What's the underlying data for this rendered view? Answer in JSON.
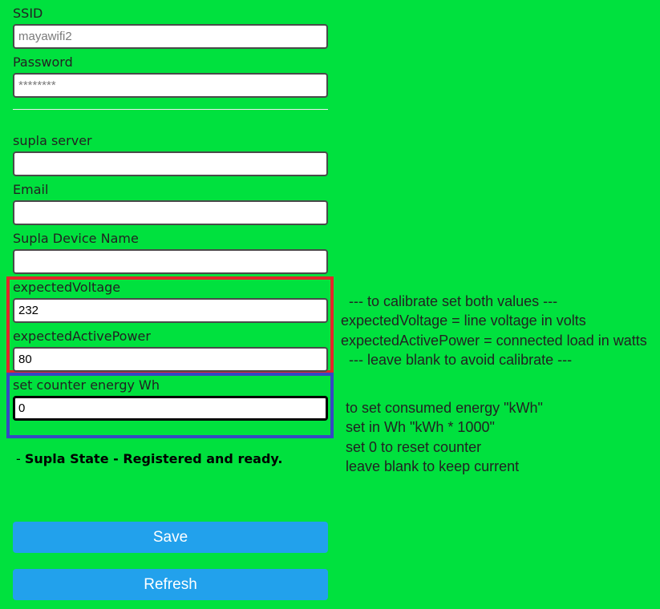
{
  "wifi": {
    "ssid_label": "SSID",
    "ssid_placeholder": "mayawifi2",
    "ssid_value": "",
    "password_label": "Password",
    "password_placeholder": "********",
    "password_value": ""
  },
  "supla": {
    "server_label": "supla server",
    "server_value": "",
    "email_label": "Email",
    "email_value": "",
    "device_name_label": "Supla Device Name",
    "device_name_value": ""
  },
  "calibration": {
    "voltage_label": "expectedVoltage",
    "voltage_value": "232",
    "power_label": "expectedActivePower",
    "power_value": "80",
    "box_color": "#e2262a"
  },
  "counter": {
    "label": "set counter energy Wh",
    "value": "0",
    "box_color": "#3547c5"
  },
  "status": {
    "prefix": "- ",
    "text": "Supla State - Registered and ready."
  },
  "buttons": {
    "save_label": "Save",
    "refresh_label": "Refresh",
    "color": "#22a1ec"
  },
  "notes": {
    "calibration": [
      "  --- to calibrate set both values ---",
      "expectedVoltage = line voltage in volts",
      "expectedActivePower = connected load in watts",
      "  --- leave blank to avoid calibrate ---"
    ],
    "counter": [
      "to set consumed energy \"kWh\"",
      "set in Wh \"kWh * 1000\"",
      "set 0 to reset counter",
      "leave blank to keep current"
    ]
  },
  "theme": {
    "background": "#00e13e"
  }
}
